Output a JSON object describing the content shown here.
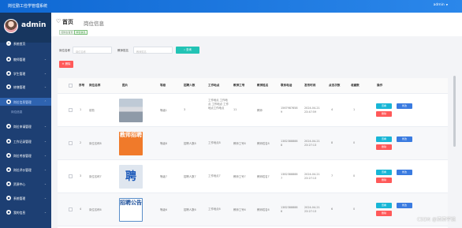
{
  "topbar": {
    "title": "岗位勤工俭学管理系统",
    "user": "admin",
    "caret": "▼"
  },
  "sidebar": {
    "username": "admin",
    "items": [
      {
        "label": "系统首页",
        "icon": "home-icon",
        "glyph": "⌂"
      },
      {
        "label": "教师管理",
        "icon": "user-icon",
        "glyph": "●",
        "caret": "⌄"
      },
      {
        "label": "学生管理",
        "icon": "student-icon",
        "glyph": "●",
        "caret": "⌄"
      },
      {
        "label": "修缮管理",
        "icon": "tool-icon",
        "glyph": "●",
        "caret": "⌄"
      },
      {
        "label": "岗位信息管理",
        "icon": "job-icon",
        "glyph": "●",
        "caret": "⌃",
        "active": true
      },
      {
        "label": "岗位申请管理",
        "icon": "apply-icon",
        "glyph": "●",
        "caret": "⌄"
      },
      {
        "label": "工作记录管理",
        "icon": "record-icon",
        "glyph": "●",
        "caret": "⌄"
      },
      {
        "label": "岗位考核管理",
        "icon": "assess-icon",
        "glyph": "●",
        "caret": "⌄"
      },
      {
        "label": "岗位评价管理",
        "icon": "review-icon",
        "glyph": "●",
        "caret": "⌄"
      },
      {
        "label": "资源中心",
        "icon": "resource-icon",
        "glyph": "●",
        "caret": "⌄"
      },
      {
        "label": "系统管理",
        "icon": "settings-icon",
        "glyph": "●",
        "caret": "⌄"
      },
      {
        "label": "我的信息",
        "icon": "profile-icon",
        "glyph": "●",
        "caret": "⌄"
      }
    ],
    "submenu": {
      "label": "岗位信息"
    }
  },
  "page": {
    "home": "首页",
    "title": "岗位信息",
    "breadcrumbs": [
      "控制台首页",
      "岗位信息"
    ]
  },
  "search": {
    "name_label": "岗位名称",
    "name_placeholder": "岗位名称",
    "teacher_label": "教师姓名",
    "teacher_placeholder": "教师姓名",
    "search_button": "查询",
    "delete_button": "删除"
  },
  "table": {
    "headers": [
      "序号",
      "岗位名称",
      "图片",
      "等级",
      "招聘人数",
      "工作地点",
      "教师工号",
      "教师姓名",
      "联系电话",
      "发布时间",
      "点击次数",
      "收藏数",
      "操作"
    ],
    "rows": [
      {
        "index": "1",
        "name": "前勤",
        "image": "campus-photo",
        "image_text": "",
        "level": "等级1",
        "recruit": "3",
        "location": "工作地点 工作地点 工作地点 工作地点工作地点",
        "teacher_id": "11",
        "teacher_name": "教师",
        "phone": "15679876589",
        "time": "2024-04-21 23:47:59",
        "clicks": "4",
        "favorites": "1"
      },
      {
        "index": "2",
        "name": "岗位名称8",
        "image": "jiaoshi-zhaopin-poster",
        "image_text": "教师招聘",
        "level": "等级8",
        "recruit": "招聘人数8",
        "location": "工作地点8",
        "teacher_id": "教师工号8",
        "teacher_name": "教师姓名8",
        "phone": "13823888888",
        "time": "2024-04-21 23:27:13",
        "clicks": "8",
        "favorites": "0"
      },
      {
        "index": "3",
        "name": "岗位名称7",
        "image": "pin-character-poster",
        "image_text": "聘",
        "level": "等级7",
        "recruit": "招聘人数7",
        "location": "工作地点7",
        "teacher_id": "教师工号7",
        "teacher_name": "教师姓名7",
        "phone": "13823888887",
        "time": "2024-04-21 23:27:13",
        "clicks": "7",
        "favorites": "0"
      },
      {
        "index": "4",
        "name": "岗位名称6",
        "image": "zhaopin-gonggao-poster",
        "image_text": "招聘公告",
        "level": "等级6",
        "recruit": "招聘人数6",
        "location": "工作地点6",
        "teacher_id": "教师工号6",
        "teacher_name": "教师姓名6",
        "phone": "13823888886",
        "time": "2024-04-21 23:27:13",
        "clicks": "6",
        "favorites": "0"
      }
    ],
    "actions": {
      "view": "查看",
      "edit": "修改",
      "delete": "删除"
    }
  },
  "watermark": "CSDN @清清学姐",
  "colors": {
    "topbar": "#1f7ae0",
    "sidebar": "#1d3f73",
    "sidebar_active": "#2e63b0",
    "search_button": "#22c3b5",
    "danger": "#ff5959",
    "edit": "#3a7be0",
    "view": "#18b6d6"
  }
}
